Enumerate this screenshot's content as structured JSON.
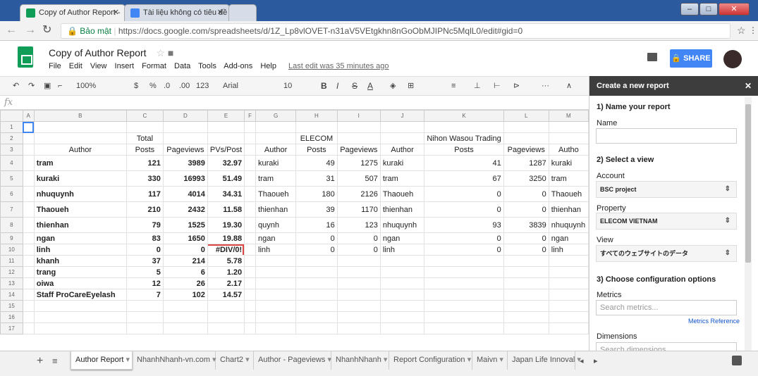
{
  "browser": {
    "tabs": [
      {
        "title": "Copy of Author Report - ",
        "color": "#0f9d58"
      },
      {
        "title": "Tài liệu không có tiêu đề",
        "color": "#4285f4"
      }
    ],
    "secure_label": "Bảo mật",
    "url": "https://docs.google.com/spreadsheets/d/1Z_Lp8vlOVET-n31aV5VEtgkhn8nGoObMJIPNc5MqlL0/edit#gid=0"
  },
  "app": {
    "title": "Copy of Author Report",
    "menu": [
      "File",
      "Edit",
      "View",
      "Insert",
      "Format",
      "Data",
      "Tools",
      "Add-ons",
      "Help"
    ],
    "last_edit": "Last edit was 35 minutes ago",
    "share_label": "SHARE"
  },
  "toolbar": {
    "zoom": "100%",
    "currency": "$",
    "percent": "%",
    "dec_less": ".0",
    "dec_more": ".00",
    "number_format": "123",
    "font": "Arial",
    "font_size": "10",
    "bold": "B",
    "italic": "I",
    "strike": "S",
    "underline_a": "A",
    "more": "···"
  },
  "formula_bar": {
    "fx": "fx"
  },
  "grid": {
    "col_headers": [
      "A",
      "B",
      "C",
      "D",
      "E",
      "F",
      "G",
      "H",
      "I",
      "J",
      "K",
      "L",
      "M"
    ],
    "row_numbers": [
      "1",
      "2",
      "3",
      "4",
      "5",
      "6",
      "7",
      "8",
      "9",
      "10",
      "11",
      "12",
      "13",
      "14",
      "15",
      "16",
      "17"
    ],
    "group_total": "Total",
    "group_elecom": "ELECOM",
    "group_nihon": "Nihon Wasou Trading",
    "headers": [
      "Author",
      "Posts",
      "Pageviews",
      "PVs/Post",
      "Author",
      "Posts",
      "Pageviews",
      "Author",
      "Posts",
      "Pageviews",
      "Autho"
    ],
    "rows": [
      [
        "tram",
        "121",
        "3989",
        "32.97",
        "kuraki",
        "49",
        "1275",
        "kuraki",
        "41",
        "1287",
        "kuraki"
      ],
      [
        "kuraki",
        "330",
        "16993",
        "51.49",
        "tram",
        "31",
        "507",
        "tram",
        "67",
        "3250",
        "tram"
      ],
      [
        "nhuquynh",
        "117",
        "4014",
        "34.31",
        "Thaoueh",
        "180",
        "2126",
        "Thaoueh",
        "0",
        "0",
        "Thaoueh"
      ],
      [
        "Thaoueh",
        "210",
        "2432",
        "11.58",
        "thienhan",
        "39",
        "1170",
        "thienhan",
        "0",
        "0",
        "thienhan"
      ],
      [
        "thienhan",
        "79",
        "1525",
        "19.30",
        "quynh",
        "16",
        "123",
        "nhuquynh",
        "93",
        "3839",
        "nhuquynh"
      ],
      [
        "ngan",
        "83",
        "1650",
        "19.88",
        "ngan",
        "0",
        "0",
        "ngan",
        "0",
        "0",
        "ngan"
      ],
      [
        "linh",
        "0",
        "0",
        "#DIV/0!",
        "linh",
        "0",
        "0",
        "linh",
        "0",
        "0",
        "linh"
      ],
      [
        "khanh",
        "37",
        "214",
        "5.78",
        "",
        "",
        "",
        "",
        "",
        "",
        ""
      ],
      [
        "trang",
        "5",
        "6",
        "1.20",
        "",
        "",
        "",
        "",
        "",
        "",
        ""
      ],
      [
        "oiwa",
        "12",
        "26",
        "2.17",
        "",
        "",
        "",
        "",
        "",
        "",
        ""
      ],
      [
        "Staff ProCareEyelash",
        "7",
        "102",
        "14.57",
        "",
        "",
        "",
        "",
        "",
        "",
        ""
      ]
    ]
  },
  "sheet_tabs": [
    "Author Report",
    "NhanhNhanh-vn.com",
    "Chart2",
    "Author - Pageviews",
    "NhanhNhanh",
    "Report Configuration",
    "Maivn",
    "Japan Life Innoval"
  ],
  "panel": {
    "title": "Create a new report",
    "step1": "1) Name your report",
    "name_label": "Name",
    "step2": "2) Select a view",
    "account_label": "Account",
    "account_value": "BSC project",
    "property_label": "Property",
    "property_value": "ELECOM VIETNAM",
    "view_label": "View",
    "view_value": "すべてのウェブサイトのデータ",
    "step3": "3) Choose configuration options",
    "metrics_label": "Metrics",
    "metrics_placeholder": "Search metrics...",
    "metrics_ref": "Metrics Reference",
    "dimensions_label": "Dimensions",
    "dimensions_placeholder": "Search dimensions..."
  }
}
